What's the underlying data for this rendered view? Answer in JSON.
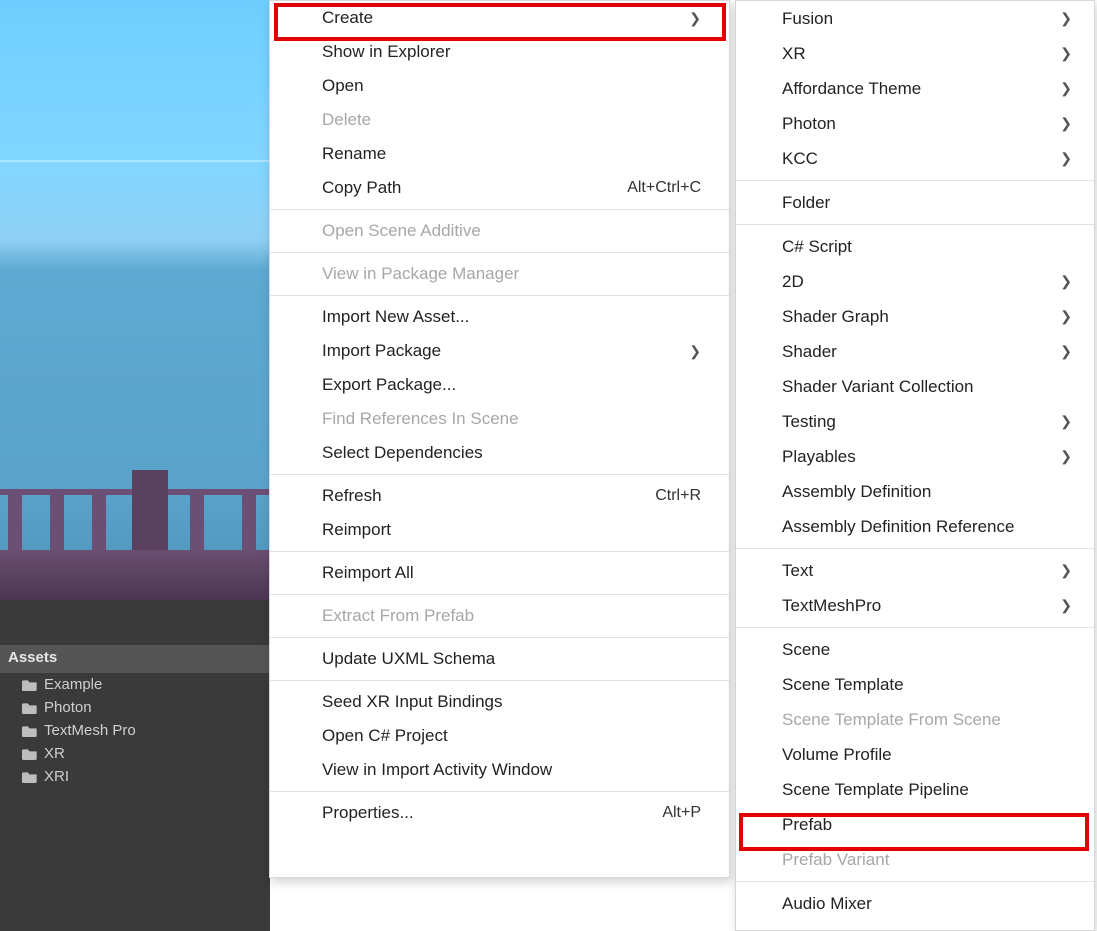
{
  "scene": {},
  "assets": {
    "header": "Assets",
    "items": [
      {
        "label": "Example"
      },
      {
        "label": "Photon"
      },
      {
        "label": "TextMesh Pro"
      },
      {
        "label": "XR"
      },
      {
        "label": "XRI"
      }
    ]
  },
  "menu1": [
    {
      "label": "Create",
      "submenu": true,
      "highlight": true
    },
    {
      "label": "Show in Explorer"
    },
    {
      "label": "Open"
    },
    {
      "label": "Delete",
      "disabled": true
    },
    {
      "label": "Rename"
    },
    {
      "label": "Copy Path",
      "shortcut": "Alt+Ctrl+C"
    },
    {
      "sep": true
    },
    {
      "label": "Open Scene Additive",
      "disabled": true
    },
    {
      "sep": true
    },
    {
      "label": "View in Package Manager",
      "disabled": true
    },
    {
      "sep": true
    },
    {
      "label": "Import New Asset..."
    },
    {
      "label": "Import Package",
      "submenu": true
    },
    {
      "label": "Export Package..."
    },
    {
      "label": "Find References In Scene",
      "disabled": true
    },
    {
      "label": "Select Dependencies"
    },
    {
      "sep": true
    },
    {
      "label": "Refresh",
      "shortcut": "Ctrl+R"
    },
    {
      "label": "Reimport"
    },
    {
      "sep": true
    },
    {
      "label": "Reimport All"
    },
    {
      "sep": true
    },
    {
      "label": "Extract From Prefab",
      "disabled": true
    },
    {
      "sep": true
    },
    {
      "label": "Update UXML Schema"
    },
    {
      "sep": true
    },
    {
      "label": "Seed XR Input Bindings"
    },
    {
      "label": "Open C# Project"
    },
    {
      "label": "View in Import Activity Window"
    },
    {
      "sep": true
    },
    {
      "label": "Properties...",
      "shortcut": "Alt+P"
    }
  ],
  "menu2": [
    {
      "label": "Fusion",
      "submenu": true
    },
    {
      "label": "XR",
      "submenu": true
    },
    {
      "label": "Affordance Theme",
      "submenu": true
    },
    {
      "label": "Photon",
      "submenu": true
    },
    {
      "label": "KCC",
      "submenu": true
    },
    {
      "sep": true
    },
    {
      "label": "Folder"
    },
    {
      "sep": true
    },
    {
      "label": "C# Script"
    },
    {
      "label": "2D",
      "submenu": true
    },
    {
      "label": "Shader Graph",
      "submenu": true
    },
    {
      "label": "Shader",
      "submenu": true
    },
    {
      "label": "Shader Variant Collection"
    },
    {
      "label": "Testing",
      "submenu": true
    },
    {
      "label": "Playables",
      "submenu": true
    },
    {
      "label": "Assembly Definition"
    },
    {
      "label": "Assembly Definition Reference"
    },
    {
      "sep": true
    },
    {
      "label": "Text",
      "submenu": true
    },
    {
      "label": "TextMeshPro",
      "submenu": true
    },
    {
      "sep": true
    },
    {
      "label": "Scene"
    },
    {
      "label": "Scene Template"
    },
    {
      "label": "Scene Template From Scene",
      "disabled": true
    },
    {
      "label": "Volume Profile"
    },
    {
      "label": "Scene Template Pipeline"
    },
    {
      "label": "Prefab",
      "highlight": true
    },
    {
      "label": "Prefab Variant",
      "disabled": true
    },
    {
      "sep": true
    },
    {
      "label": "Audio Mixer"
    }
  ]
}
